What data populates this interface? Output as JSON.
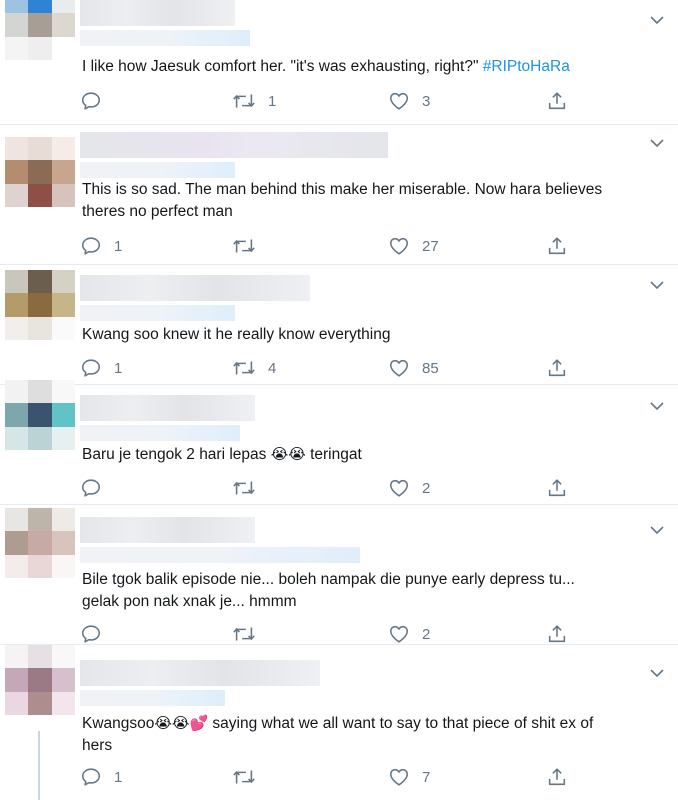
{
  "tweets": [
    {
      "text": "I like how Jaesuk comfort her. \"it's was exhausting, right?\" ",
      "hashtag": "#RIPtoHaRa",
      "replies": "",
      "retweets": "1",
      "likes": "3"
    },
    {
      "text": "This is so sad. The man behind this make her miserable. Now hara believes\ntheres no perfect man",
      "replies": "1",
      "retweets": "",
      "likes": "27"
    },
    {
      "text": "Kwang soo knew it he really know everything",
      "replies": "1",
      "retweets": "4",
      "likes": "85"
    },
    {
      "text_a": "Baru je tengok 2 hari lepas ",
      "emoji_a": "😭😭",
      "text_b": " teringat",
      "replies": "",
      "retweets": "",
      "likes": "2"
    },
    {
      "text": "Bile tgok balik episode nie... boleh nampak die punye early depress tu...\ngelak pon nak xnak je... hmmm",
      "replies": "",
      "retweets": "",
      "likes": "2"
    },
    {
      "text_a": "Kwangsoo",
      "emoji_a": "😭😭💕",
      "text_b": " saying what we all want to say to that piece of shit ex of\nhers",
      "replies": "1",
      "retweets": "",
      "likes": "7"
    }
  ],
  "icons": {
    "reply": "reply-icon",
    "retweet": "retweet-icon",
    "like": "heart-icon",
    "share": "share-icon",
    "menu": "chevron-down-icon"
  },
  "colors": {
    "hashtag": "#1b95e0",
    "icon": "#657786",
    "text": "#14171a",
    "thread_line": "#ccd6dd"
  }
}
